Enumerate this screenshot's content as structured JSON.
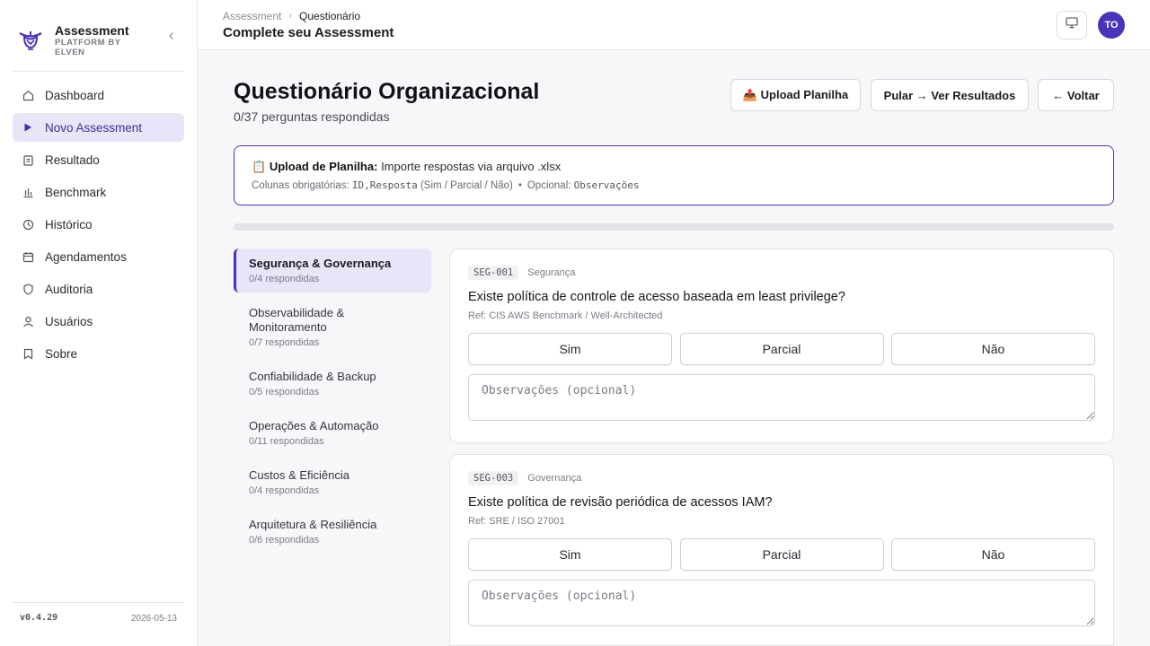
{
  "brand": {
    "title": "Assessment",
    "subtitle": "PLATFORM BY ELVEN",
    "collapse_icon": "chevron-left-icon"
  },
  "nav": [
    {
      "label": "Dashboard",
      "icon": "home-icon"
    },
    {
      "label": "Novo Assessment",
      "icon": "play-icon",
      "active": true
    },
    {
      "label": "Resultado",
      "icon": "clipboard-icon"
    },
    {
      "label": "Benchmark",
      "icon": "bar-chart-icon"
    },
    {
      "label": "Histórico",
      "icon": "clock-icon"
    },
    {
      "label": "Agendamentos",
      "icon": "calendar-icon"
    },
    {
      "label": "Auditoria",
      "icon": "shield-icon"
    },
    {
      "label": "Usuários",
      "icon": "user-icon"
    },
    {
      "label": "Sobre",
      "icon": "bookmark-icon"
    }
  ],
  "footer": {
    "version": "v0.4.29",
    "date": "2026-05-13"
  },
  "topbar": {
    "breadcrumb_root": "Assessment",
    "breadcrumb_current": "Questionário",
    "heading": "Complete seu Assessment",
    "avatar_initials": "TO"
  },
  "main": {
    "title": "Questionário Organizacional",
    "progress_text": "0/37 perguntas respondidas",
    "progress_fraction": 0,
    "buttons": {
      "upload": "📤 Upload Planilha",
      "skip": "Pular → Ver Resultados",
      "back": "← Voltar"
    }
  },
  "upload_box": {
    "icon": "📋",
    "label": "Upload de Planilha:",
    "desc": "Importe respostas via arquivo .xlsx",
    "cols_label": "Colunas obrigatórias:",
    "col_id": "ID,",
    "col_resposta": "Resposta",
    "col_values": "(Sim / Parcial / Não)",
    "optional_label": "Opcional:",
    "optional_col": "Observações"
  },
  "categories": [
    {
      "name": "Segurança & Governança",
      "count": "0/4 respondidas",
      "active": true
    },
    {
      "name": "Observabilidade & Monitoramento",
      "count": "0/7 respondidas"
    },
    {
      "name": "Confiabilidade & Backup",
      "count": "0/5 respondidas"
    },
    {
      "name": "Operações & Automação",
      "count": "0/11 respondidas"
    },
    {
      "name": "Custos & Eficiência",
      "count": "0/4 respondidas"
    },
    {
      "name": "Arquitetura & Resiliência",
      "count": "0/6 respondidas"
    }
  ],
  "questions": [
    {
      "code": "SEG-001",
      "category": "Segurança",
      "text": "Existe política de controle de acesso baseada em least privilege?",
      "ref": "Ref: CIS AWS Benchmark / Well-Architected",
      "answers": [
        "Sim",
        "Parcial",
        "Não"
      ],
      "obs_placeholder": "Observações (opcional)"
    },
    {
      "code": "SEG-003",
      "category": "Governança",
      "text": "Existe política de revisão periódica de acessos IAM?",
      "ref": "Ref: SRE / ISO 27001",
      "answers": [
        "Sim",
        "Parcial",
        "Não"
      ],
      "obs_placeholder": "Observações (opcional)"
    }
  ]
}
